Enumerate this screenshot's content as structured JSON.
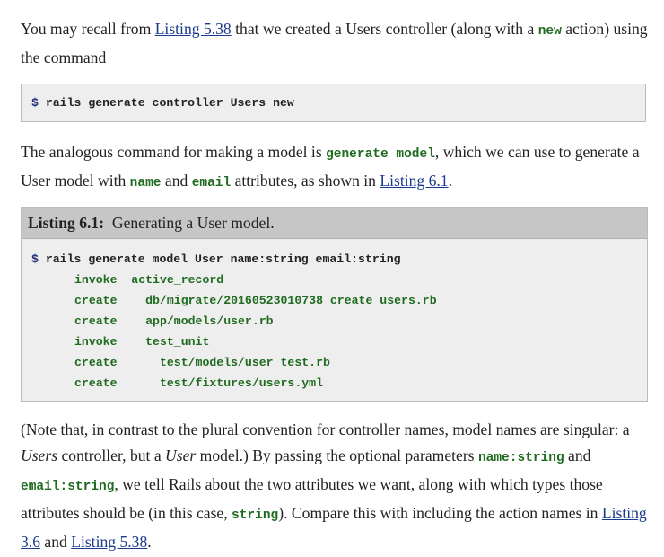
{
  "para1": {
    "t1": "You may recall from ",
    "link1": "Listing 5.38",
    "t2": " that we created a Users controller (along with a ",
    "code1": "new",
    "t3": " action) using the command"
  },
  "command_box": {
    "prompt": "$",
    "command": " rails generate controller Users new"
  },
  "para2": {
    "t1": "The analogous command for making a model is ",
    "code1": "generate model",
    "t2": ", which we can use to generate a User model with ",
    "code2": "name",
    "t3": " and ",
    "code3": "email",
    "t4": " attributes, as shown in ",
    "link1": "Listing 6.1",
    "t5": "."
  },
  "listing": {
    "label": "Listing 6.1:",
    "caption": "Generating a User model.",
    "prompt": "$",
    "command": " rails generate model User name:string email:string",
    "lines": [
      "invoke  active_record",
      "create    db/migrate/20160523010738_create_users.rb",
      "create    app/models/user.rb",
      "invoke    test_unit",
      "create      test/models/user_test.rb",
      "create      test/fixtures/users.yml"
    ]
  },
  "para3": {
    "t1": "(Note that, in contrast to the plural convention for controller names, model names are singular: a ",
    "em1": "Users",
    "t2": " controller, but a ",
    "em2": "User",
    "t3": " model.)  By passing the optional parameters ",
    "code1": "name:string",
    "t4": " and ",
    "code2": "email:string",
    "t5": ", we tell Rails about the two attributes we want, along with which types those attributes should be (in this case, ",
    "code3": "string",
    "t6": ").  Compare this with including the action names in ",
    "link1": "Listing 3.6",
    "t7": " and ",
    "link2": "Listing 5.38",
    "t8": "."
  },
  "colors": {
    "code_green": "#1f6b1f",
    "link_blue": "#1a3a8a",
    "code_bg": "#eeeeee",
    "listing_header_bg": "#c6c6c6"
  }
}
